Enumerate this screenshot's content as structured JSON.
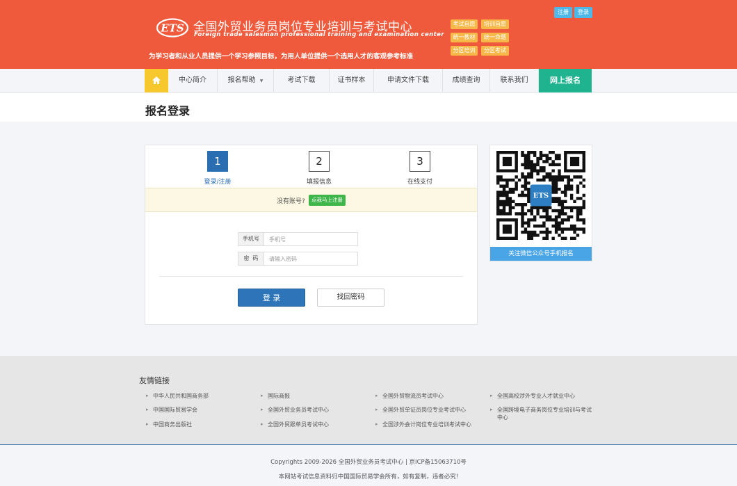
{
  "header": {
    "title": "全国外贸业务员岗位专业培训与考试中心",
    "subtitle": "Foreign trade salesman professional training and examination center",
    "slogan": "为学习者和从业人员提供一个学习参照目标，为用人单位提供一个选用人才的客观参考标准",
    "tags": [
      "考试自愿",
      "培训自愿",
      "统一教材",
      "统一命题",
      "分区培训",
      "分区考试"
    ],
    "register_label": "注册",
    "login_label": "登录",
    "brand_color": "#ef5a3c"
  },
  "nav": {
    "home_icon": "home-icon",
    "items": [
      "中心简介",
      "报名帮助",
      "考试下载",
      "证书样本",
      "申请文件下载",
      "成绩查询",
      "联系我们"
    ],
    "cta_label": "网上报名"
  },
  "page": {
    "title": "报名登录"
  },
  "steps": [
    {
      "num": "1",
      "label": "登录/注册",
      "active": true
    },
    {
      "num": "2",
      "label": "填报信息",
      "active": false
    },
    {
      "num": "3",
      "label": "在线支付",
      "active": false
    }
  ],
  "notice": {
    "text": "没有账号?",
    "button": "点我马上注册"
  },
  "form": {
    "phone_label": "手机号",
    "phone_placeholder": "手机号",
    "password_label": "密  码",
    "password_placeholder": "请输入密码",
    "login_button": "登 录",
    "find_button": "找回密码"
  },
  "qr": {
    "caption": "关注微信公众号手机报名",
    "icon": "qr-code-icon"
  },
  "links": {
    "title": "友情链接",
    "col1": [
      "中华人民共和国商务部",
      "中国国际贸易学会",
      "中国商务出版社"
    ],
    "col2": [
      "国际商报",
      "全国外贸业务员考试中心",
      "全国外贸跟单员考试中心"
    ],
    "col3": [
      "全国外贸物流员考试中心",
      "全国外贸单证员岗位专业考试中心",
      "全国涉外会计岗位专业培训考试中心"
    ],
    "col4": [
      "全国高校涉外专业人才就业中心",
      "全国跨境电子商务岗位专业培训与考试中心"
    ]
  },
  "footer": {
    "copyright": "Copyrights 2009-2026 全国外贸业务员考试中心 | 京ICP备15063710号",
    "notice": "本网站考试信息资料归中国国际贸易学会所有，如有复制，违者必究!"
  }
}
